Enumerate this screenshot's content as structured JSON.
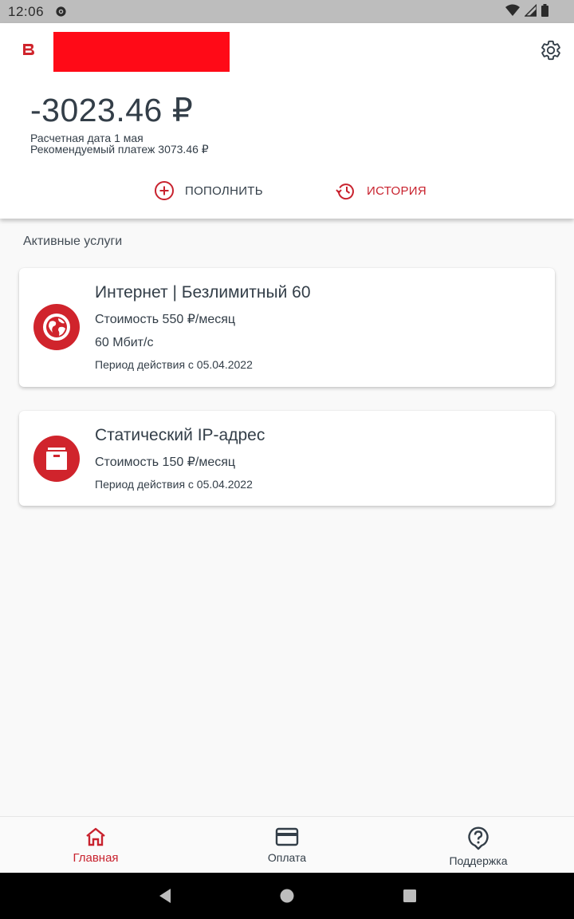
{
  "status_bar": {
    "time": "12:06"
  },
  "header": {
    "balance": "-3023.46 ₽",
    "due_date": "Расчетная дата 1 мая",
    "recommended": "Рекомендуемый платеж 3073.46 ₽",
    "topup_label": "ПОПОЛНИТЬ",
    "history_label": "ИСТОРИЯ"
  },
  "section": {
    "title": "Активные услуги"
  },
  "services": [
    {
      "title": "Интернет | Безлимитный 60",
      "cost": "Стоимость 550 ₽/месяц",
      "speed": "60 Мбит/с",
      "period": "Период действия с 05.04.2022"
    },
    {
      "title": "Статический IP-адрес",
      "cost": "Стоимость 150 ₽/месяц",
      "period": "Период действия с 05.04.2022"
    }
  ],
  "bottom_nav": {
    "home": "Главная",
    "payment": "Оплата",
    "support": "Поддержка"
  },
  "colors": {
    "accent": "#c8222e",
    "text": "#333e48",
    "redacted": "#ff0a17"
  },
  "icons": [
    "cast-icon",
    "wifi-icon",
    "signal-icon",
    "battery-icon",
    "brand-logo-icon",
    "gear-icon",
    "plus-circle-icon",
    "history-icon",
    "globe-icon",
    "archive-icon",
    "home-icon",
    "credit-card-icon",
    "help-bubble-icon",
    "back-icon",
    "home-circle-icon",
    "recents-icon"
  ]
}
